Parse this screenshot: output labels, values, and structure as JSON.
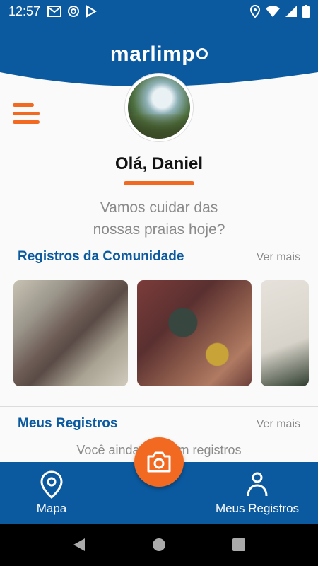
{
  "status_bar": {
    "time": "12:57",
    "icons_left": [
      "gmail-icon",
      "at-sign-icon",
      "play-store-icon"
    ],
    "icons_right": [
      "location-icon",
      "wifi-icon",
      "signal-icon",
      "battery-icon"
    ]
  },
  "header": {
    "logo_text": "marlimp",
    "brand_color": "#0b5aa0",
    "accent_color": "#f26a21"
  },
  "profile": {
    "greeting": "Olá, Daniel",
    "subtitle_line1": "Vamos cuidar das",
    "subtitle_line2": "nossas praias hoje?"
  },
  "community": {
    "title": "Registros da Comunidade",
    "more": "Ver mais"
  },
  "my_records": {
    "title": "Meus Registros",
    "more": "Ver mais",
    "empty_text": "Você ainda não tem registros"
  },
  "bottom_nav": {
    "mapa": "Mapa",
    "meus_registros": "Meus Registros"
  }
}
